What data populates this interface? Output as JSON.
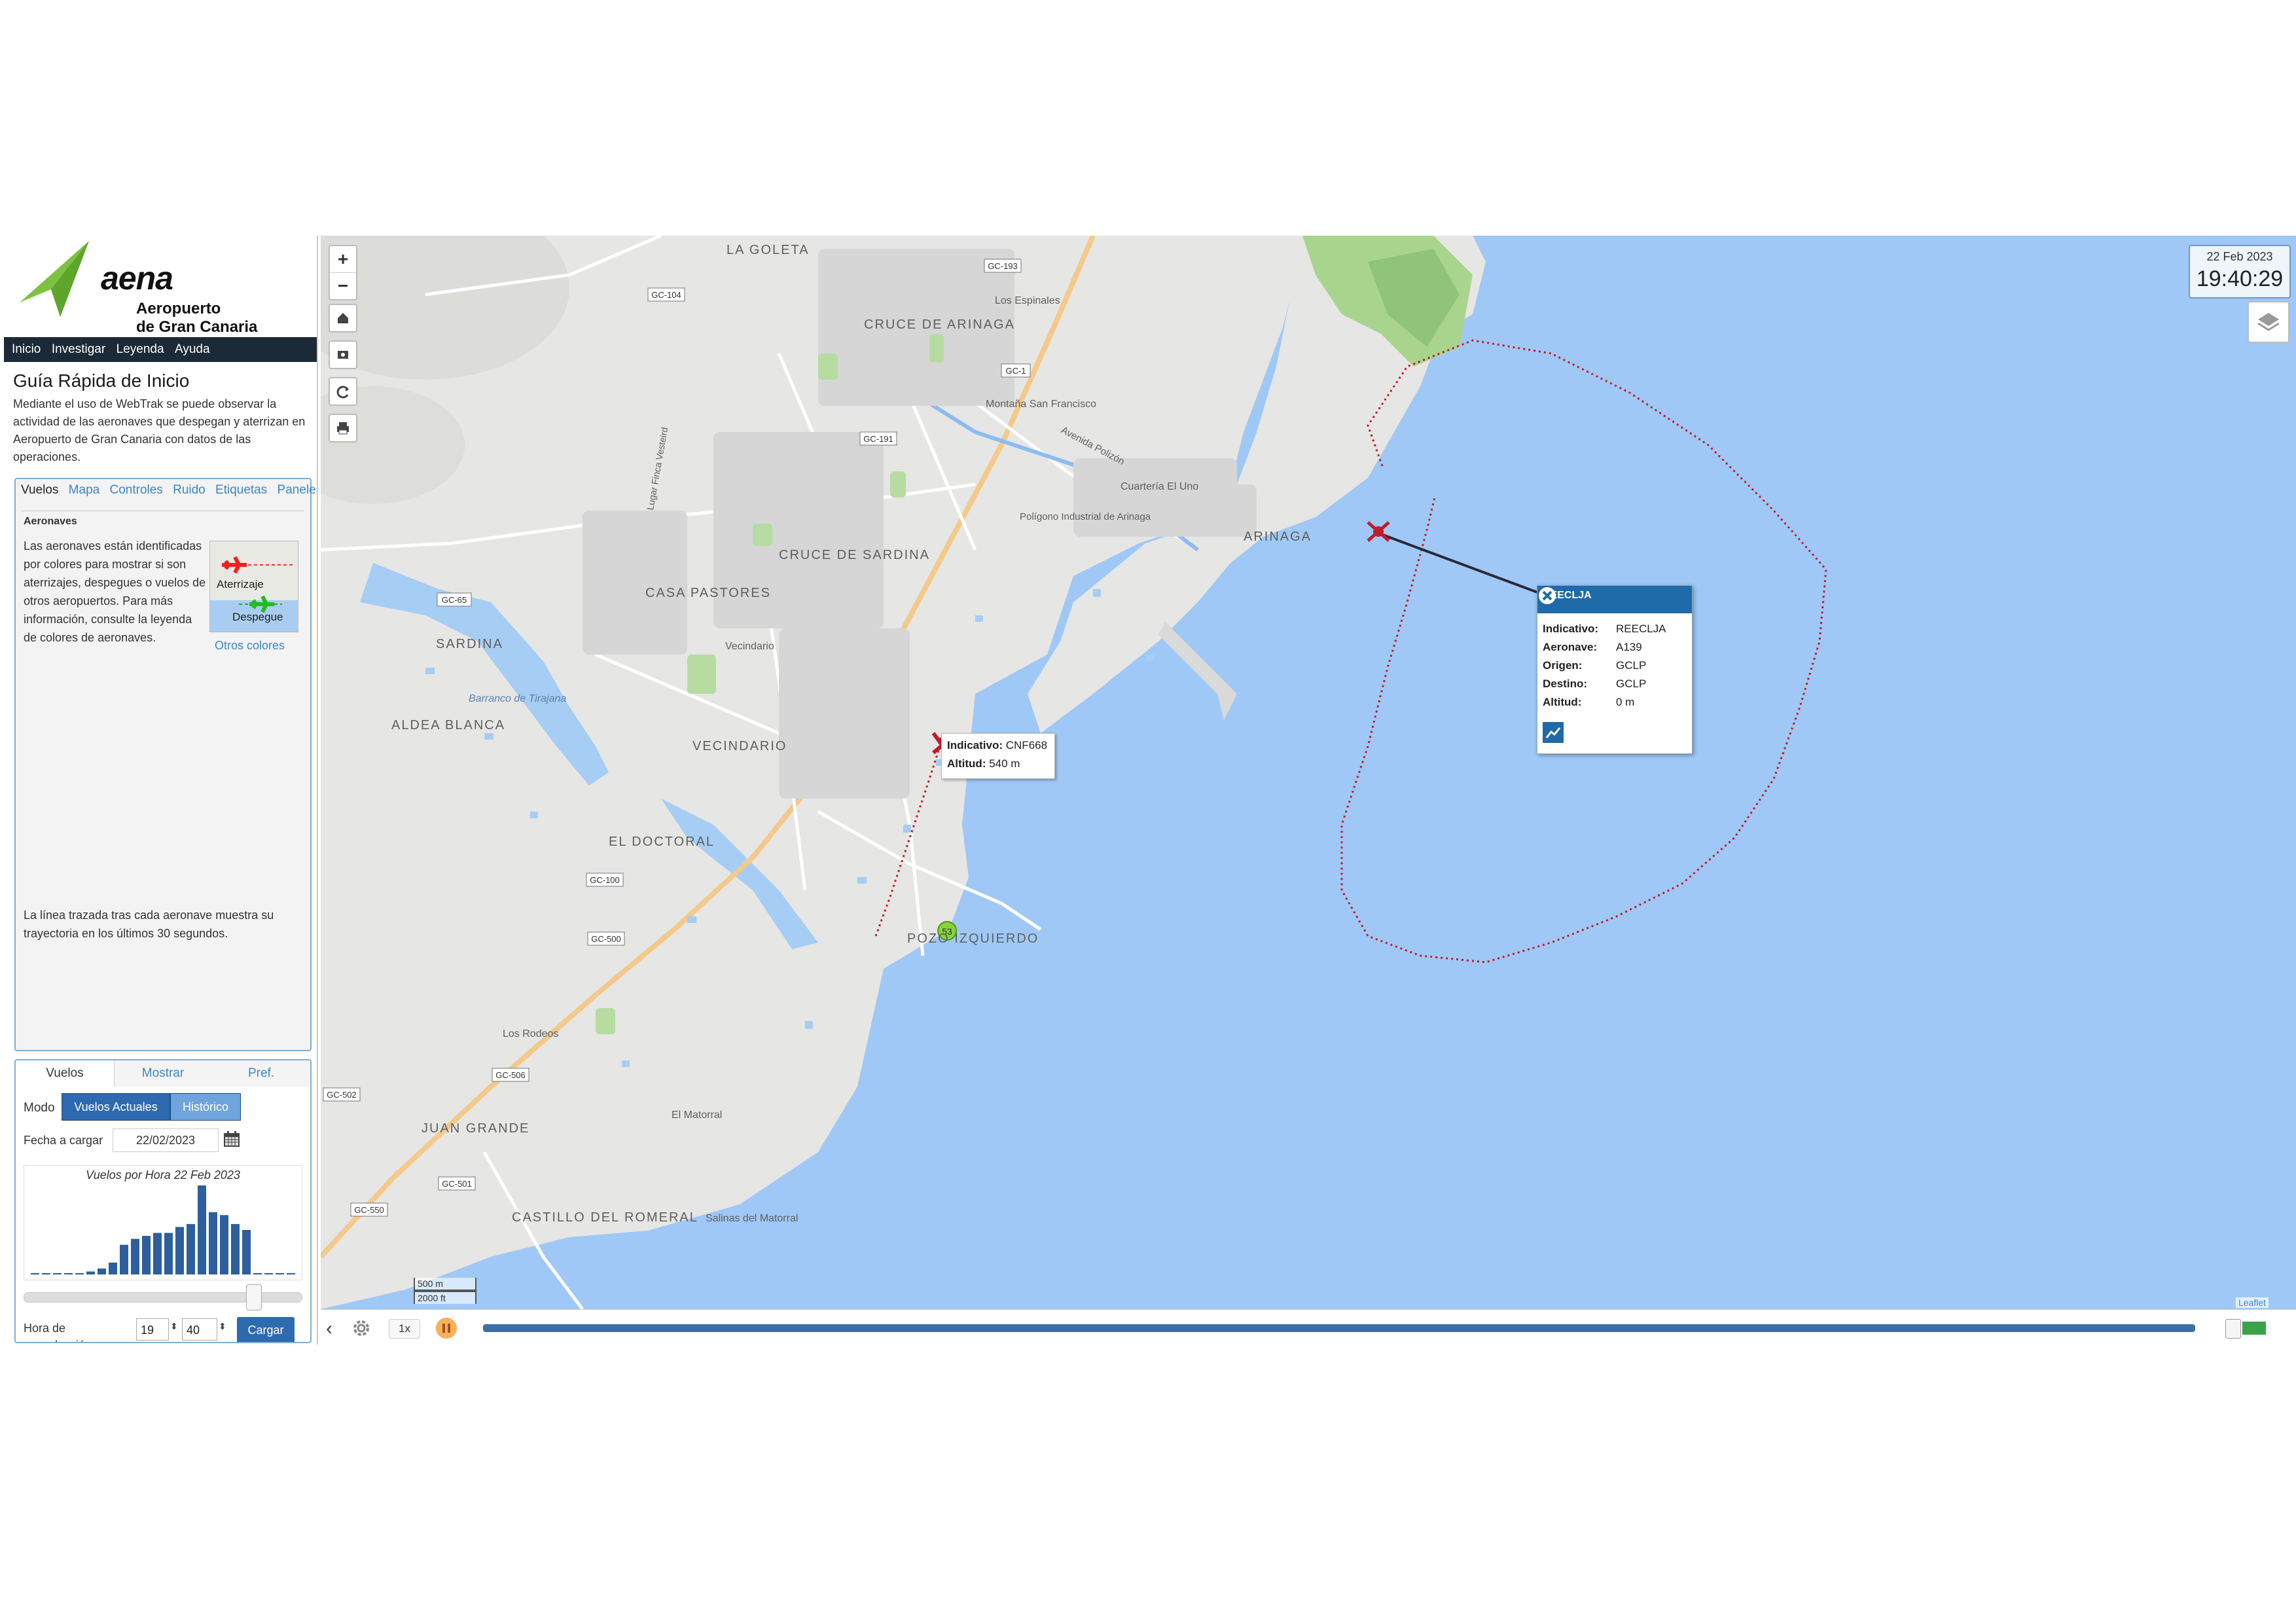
{
  "brand": {
    "name": "aena",
    "subtitle_line1": "Aeropuerto",
    "subtitle_line2": "de Gran Canaria",
    "colors": {
      "green": "#7dc242",
      "dark_nav": "#1b2a36",
      "accent_blue": "#2d6ab0"
    }
  },
  "topnav": [
    "Inicio",
    "Investigar",
    "Leyenda",
    "Ayuda"
  ],
  "intro": {
    "title": "Guía Rápida de Inicio",
    "text": "Mediante el uso de WebTrak se puede observar la actividad de las aeronaves que despegan y aterrizan en Aeropuerto de Gran Canaria con datos de las operaciones."
  },
  "help": {
    "tabs": [
      "Vuelos",
      "Mapa",
      "Controles",
      "Ruido",
      "Etiquetas",
      "Paneles"
    ],
    "active_tab": "Vuelos",
    "section_title": "Aeronaves",
    "text1": "Las aeronaves están identificadas por colores para mostrar si son aterrizajes, despegues o vuelos de otros aeropuertos. Para más información, consulte la leyenda de colores de aeronaves.",
    "legend_landing": "Aterrizaje",
    "legend_takeoff": "Despegue",
    "other_colors_link": "Otros colores",
    "text2": "La línea trazada tras cada aeronave muestra su trayectoria en los últimos 30 segundos."
  },
  "controls": {
    "tabs": [
      "Vuelos",
      "Mostrar",
      "Pref."
    ],
    "mode_label": "Modo",
    "mode_current": "Vuelos Actuales",
    "mode_history": "Histórico",
    "date_label": "Fecha a cargar",
    "date_value": "22/02/2023",
    "histogram_title": "Vuelos por Hora 22 Feb 2023",
    "histogram_values": [
      0,
      0,
      0,
      0,
      0,
      1,
      2,
      4,
      10,
      12,
      13,
      14,
      14,
      16,
      17,
      30,
      21,
      20,
      17,
      15,
      0,
      0,
      0,
      0
    ],
    "playback_hour_label": "Hora de reproducción",
    "hour_value": "19",
    "minute_value": "40",
    "load_button": "Cargar"
  },
  "map": {
    "clock_date": "22 Feb 2023",
    "clock_time": "19:40:29",
    "zoom_in": "+",
    "zoom_out": "−",
    "place_labels": [
      "LA GOLETA",
      "CRUCE DE ARINAGA",
      "Los Espinales",
      "Montaña San Francisco",
      "Avenida Polizón",
      "Cuartería El Uno",
      "Polígono Industrial de Arinaga",
      "ARINAGA",
      "CRUCE DE SARDINA",
      "CASA PASTORES",
      "SARDINA",
      "Barranco de Tirajana",
      "ALDEA BLANCA",
      "Vecindario",
      "VECINDARIO",
      "EL DOCTORAL",
      "POZO IZQUIERDO",
      "Los Rodeos",
      "JUAN GRANDE",
      "El Matorral",
      "CASTILLO DEL ROMERAL",
      "Salinas del Matorral",
      "Lugar Finca Vesteird"
    ],
    "road_labels": [
      "GC-193",
      "GC-104",
      "GC-1",
      "GC-191",
      "GC-65",
      "GC-100",
      "GC-500",
      "GC-502",
      "GC-506",
      "GC-501",
      "GC-550"
    ],
    "poi_badge": "53",
    "flight1": {
      "callsign_label": "Indicativo:",
      "callsign": "CNF668",
      "altitude_label": "Altitud:",
      "altitude": "540 m"
    },
    "flight2": {
      "header": "REECLJA",
      "rows": [
        {
          "label": "Indicativo:",
          "value": "REECLJA"
        },
        {
          "label": "Aeronave:",
          "value": "A139"
        },
        {
          "label": "Origen:",
          "value": "GCLP"
        },
        {
          "label": "Destino:",
          "value": "GCLP"
        },
        {
          "label": "Altitud:",
          "value": "0 m"
        }
      ]
    },
    "scale_metric": "500 m",
    "scale_imperial": "2000 ft",
    "attribution": "Leaflet"
  },
  "timeline": {
    "speed": "1x"
  }
}
